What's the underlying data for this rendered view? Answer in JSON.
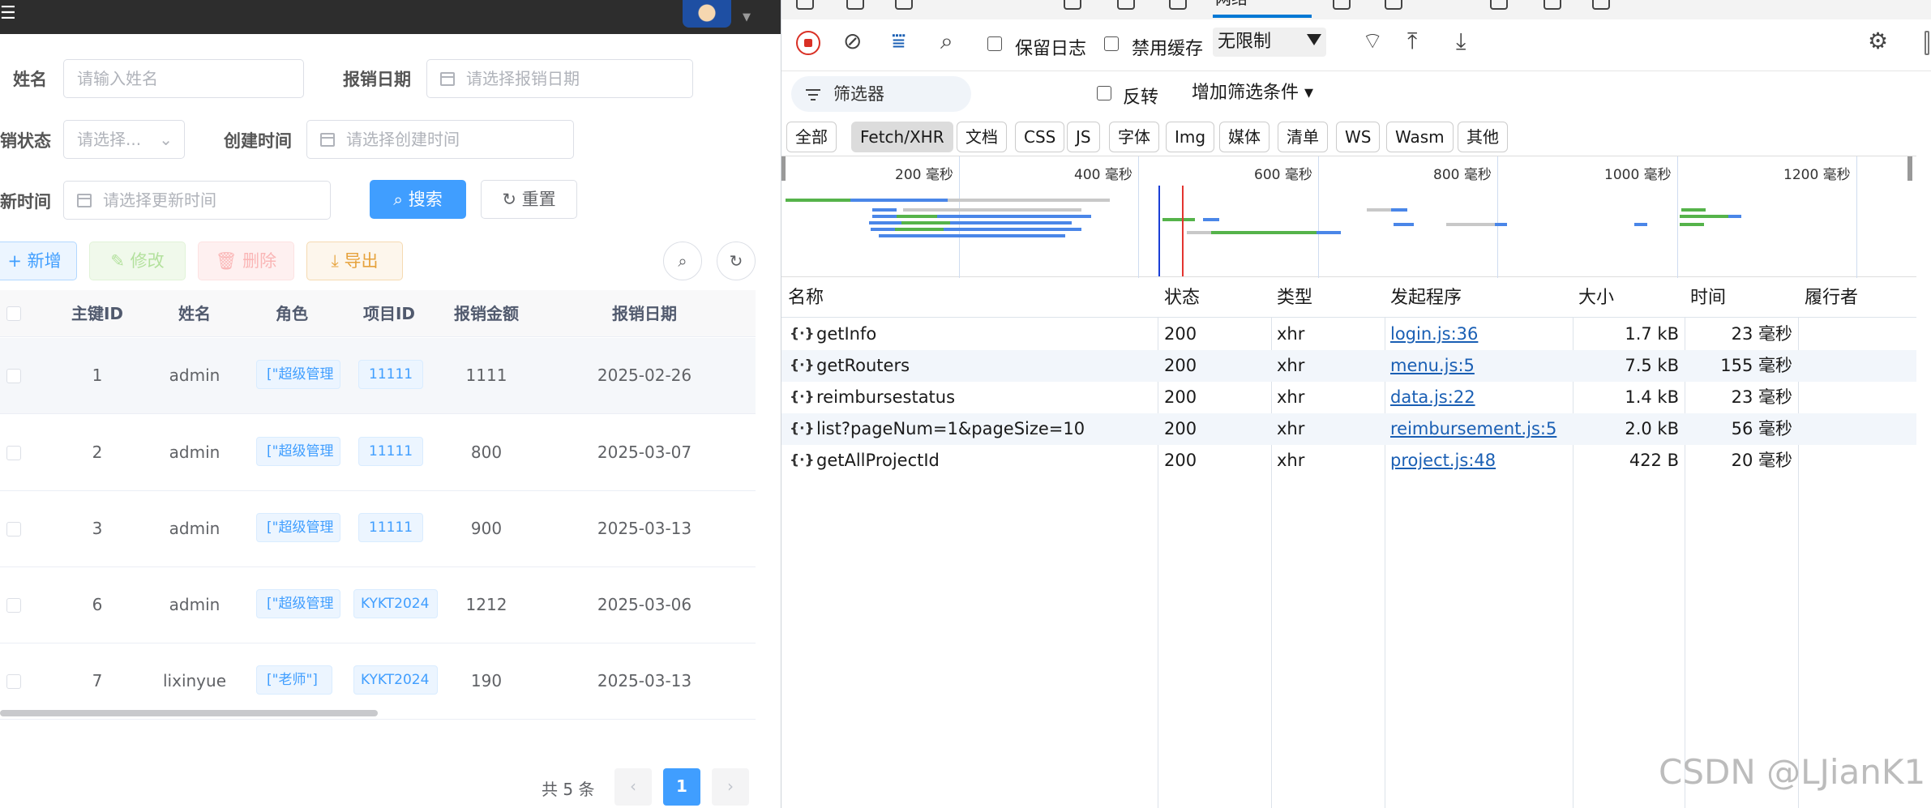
{
  "left": {
    "form": {
      "name_label": "姓名",
      "name_placeholder": "请输入姓名",
      "date_label": "报销日期",
      "date_placeholder": "请选择报销日期",
      "status_label": "销状态",
      "status_placeholder": "请选择...",
      "created_label": "创建时间",
      "created_placeholder": "请选择创建时间",
      "updated_label": "新时间",
      "updated_placeholder": "请选择更新时间",
      "search_button": "搜索",
      "reset_button": "重置"
    },
    "actions": {
      "add": "新增",
      "edit": "修改",
      "delete": "删除",
      "export": "导出"
    },
    "table": {
      "headers": [
        "主键ID",
        "姓名",
        "角色",
        "项目ID",
        "报销金额",
        "报销日期"
      ],
      "rows": [
        {
          "id": "1",
          "name": "admin",
          "role": "[\"超级管理",
          "project": "11111",
          "amount": "1111",
          "date": "2025-02-26"
        },
        {
          "id": "2",
          "name": "admin",
          "role": "[\"超级管理",
          "project": "11111",
          "amount": "800",
          "date": "2025-03-07"
        },
        {
          "id": "3",
          "name": "admin",
          "role": "[\"超级管理",
          "project": "11111",
          "amount": "900",
          "date": "2025-03-13"
        },
        {
          "id": "6",
          "name": "admin",
          "role": "[\"超级管理",
          "project": "KYKT2024",
          "amount": "1212",
          "date": "2025-03-06"
        },
        {
          "id": "7",
          "name": "lixinyue",
          "role": "[\"老师\"]",
          "project": "KYKT2024",
          "amount": "190",
          "date": "2025-03-13"
        }
      ]
    },
    "pagination": {
      "total": "共 5 条",
      "current": "1",
      "prev": "‹",
      "next": "›"
    }
  },
  "devtools": {
    "active_tab": "网络",
    "toolbar": {
      "preserve_log": "保留日志",
      "disable_cache": "禁用缓存",
      "throttle": "无限制"
    },
    "filter": {
      "placeholder": "筛选器",
      "invert": "反转",
      "more_filters": "增加筛选条件 ▾"
    },
    "type_chips": [
      "全部",
      "Fetch/XHR",
      "文档",
      "CSS",
      "JS",
      "字体",
      "Img",
      "媒体",
      "清单",
      "WS",
      "Wasm",
      "其他"
    ],
    "selected_chip": "Fetch/XHR",
    "overview_labels": [
      "200 毫秒",
      "400 毫秒",
      "600 毫秒",
      "800 毫秒",
      "1000 毫秒",
      "1200 毫秒"
    ],
    "columns": [
      "名称",
      "状态",
      "类型",
      "发起程序",
      "大小",
      "时间",
      "履行者"
    ],
    "requests": [
      {
        "name": "getInfo",
        "status": "200",
        "type": "xhr",
        "initiator": "login.js:36",
        "size": "1.7 kB",
        "time": "23 毫秒"
      },
      {
        "name": "getRouters",
        "status": "200",
        "type": "xhr",
        "initiator": "menu.js:5",
        "size": "7.5 kB",
        "time": "155 毫秒"
      },
      {
        "name": "reimbursestatus",
        "status": "200",
        "type": "xhr",
        "initiator": "data.js:22",
        "size": "1.4 kB",
        "time": "23 毫秒"
      },
      {
        "name": "list?pageNum=1&pageSize=10",
        "status": "200",
        "type": "xhr",
        "initiator": "reimbursement.js:5",
        "size": "2.0 kB",
        "time": "56 毫秒"
      },
      {
        "name": "getAllProjectId",
        "status": "200",
        "type": "xhr",
        "initiator": "project.js:48",
        "size": "422 B",
        "time": "20 毫秒"
      }
    ],
    "colors": {
      "accent": "#409eff",
      "devtools_blue": "#0078d4",
      "record_red": "#d93025"
    }
  },
  "watermark": "CSDN @LJianK1"
}
